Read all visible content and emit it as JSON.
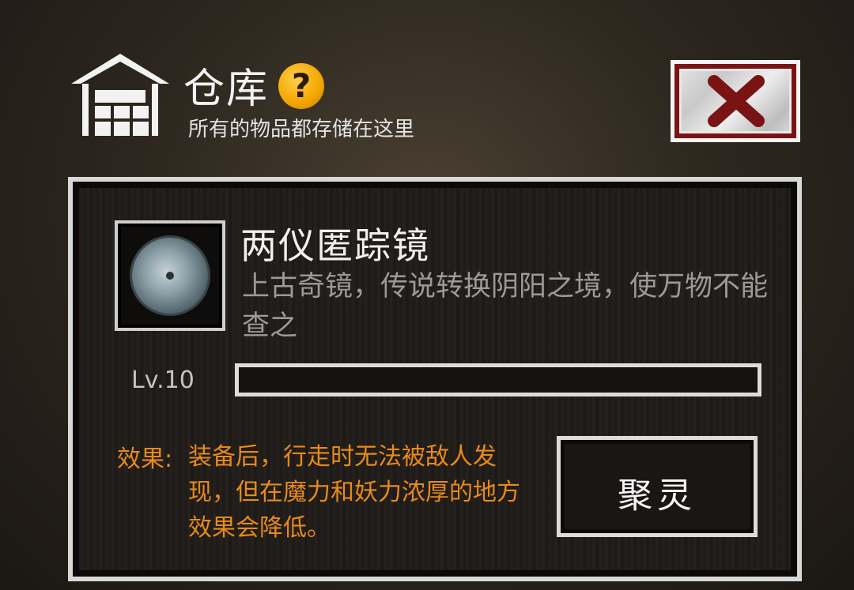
{
  "header": {
    "title": "仓库",
    "subtitle": "所有的物品都存储在这里",
    "help_icon": "question-mark-icon",
    "warehouse_icon": "warehouse-icon"
  },
  "close_button": {
    "icon": "close-x-icon"
  },
  "item": {
    "name": "两仪匿踪镜",
    "description": "上古奇镜，传说转换阴阳之境，使万物不能查之",
    "icon": "bronze-mirror-icon",
    "level": "Lv.10",
    "level_progress": 0
  },
  "effect": {
    "label": "效果:",
    "text": "装备后，行走时无法被敌人发现，但在魔力和妖力浓厚的地方效果会降低。"
  },
  "action_button": {
    "label": "聚灵"
  },
  "colors": {
    "accent_orange": "#e88a1a",
    "help_yellow": "#f3a500",
    "close_red": "#7a1414"
  }
}
